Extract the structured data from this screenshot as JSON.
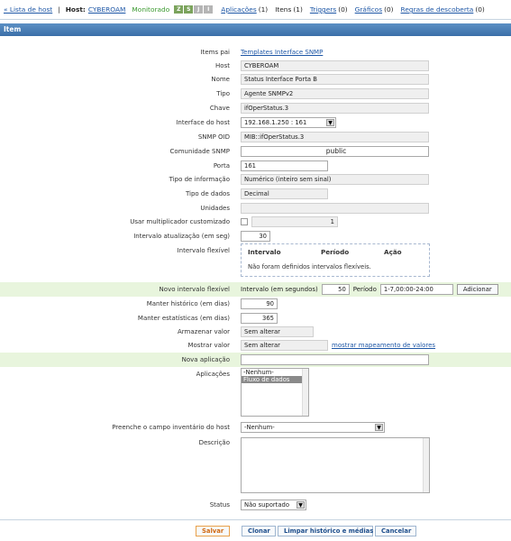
{
  "nav": {
    "host_list": "« Lista de host",
    "host_label": "Host:",
    "host_name": "CYBEROAM",
    "status": "Monitorado",
    "avail": [
      "Z",
      "S",
      "J",
      "I"
    ],
    "applications": "Aplicações",
    "applications_count": "(1)",
    "items": "Itens",
    "items_count": "(1)",
    "triggers": "Triggers",
    "triggers_count": "(0)",
    "graphs": "Gráficos",
    "graphs_count": "(0)",
    "discovery": "Regras de descoberta",
    "discovery_count": "(0)"
  },
  "title": "Item",
  "fields": {
    "items_pai": {
      "label": "Items pai",
      "value": "Templates Interface SNMP"
    },
    "host": {
      "label": "Host",
      "value": "CYBEROAM"
    },
    "nome": {
      "label": "Nome",
      "value": "Status Interface Porta B"
    },
    "tipo": {
      "label": "Tipo",
      "value": "Agente SNMPv2"
    },
    "chave": {
      "label": "Chave",
      "value": "ifOperStatus.3"
    },
    "interface": {
      "label": "Interface do host",
      "value": "192.168.1.250 : 161"
    },
    "snmp_oid": {
      "label": "SNMP OID",
      "value": "MIB::ifOperStatus.3"
    },
    "comunidade": {
      "label": "Comunidade SNMP",
      "value": "public"
    },
    "porta": {
      "label": "Porta",
      "value": "161"
    },
    "tipo_info": {
      "label": "Tipo de informação",
      "value": "Numérico (inteiro sem sinal)"
    },
    "tipo_dados": {
      "label": "Tipo de dados",
      "value": "Decimal"
    },
    "unidades": {
      "label": "Unidades",
      "value": ""
    },
    "multiplicador": {
      "label": "Usar multiplicador customizado",
      "value": "1"
    },
    "intervalo": {
      "label": "Intervalo atualização (em seg)",
      "value": "30"
    },
    "intervalo_flex": {
      "label": "Intervalo flexível",
      "col_intervalo": "Intervalo",
      "col_periodo": "Período",
      "col_acao": "Ação",
      "empty_msg": "Não foram definidos intervalos flexíveis."
    },
    "novo_intervalo": {
      "label": "Novo intervalo flexível",
      "interval_label": "Intervalo (em segundos)",
      "interval_value": "50",
      "period_label": "Período",
      "period_value": "1-7,00:00-24:00",
      "add_button": "Adicionar"
    },
    "historico": {
      "label": "Manter histórico (em dias)",
      "value": "90"
    },
    "estatisticas": {
      "label": "Manter estatísticas (em dias)",
      "value": "365"
    },
    "armazenar": {
      "label": "Armazenar valor",
      "value": "Sem alterar"
    },
    "mostrar": {
      "label": "Mostrar valor",
      "value": "Sem alterar",
      "link": "mostrar mapeamento de valores"
    },
    "nova_aplicacao": {
      "label": "Nova aplicação",
      "value": ""
    },
    "aplicacoes": {
      "label": "Aplicações",
      "options": [
        "-Nenhum-",
        "Fluxo de dados"
      ],
      "selected": "Fluxo de dados"
    },
    "inventario": {
      "label": "Preenche o campo inventário do host",
      "value": "-Nenhum-"
    },
    "descricao": {
      "label": "Descrição",
      "value": ""
    },
    "status": {
      "label": "Status",
      "value": "Não suportado"
    }
  },
  "buttons": {
    "save": "Salvar",
    "clone": "Clonar",
    "clear": "Limpar histórico e médias",
    "cancel": "Cancelar"
  },
  "colors": {
    "title_bar": "#4a7fb8",
    "highlight_row": "#e8f5dd",
    "link": "#1e57a6",
    "monitored": "#3b9a2f"
  }
}
